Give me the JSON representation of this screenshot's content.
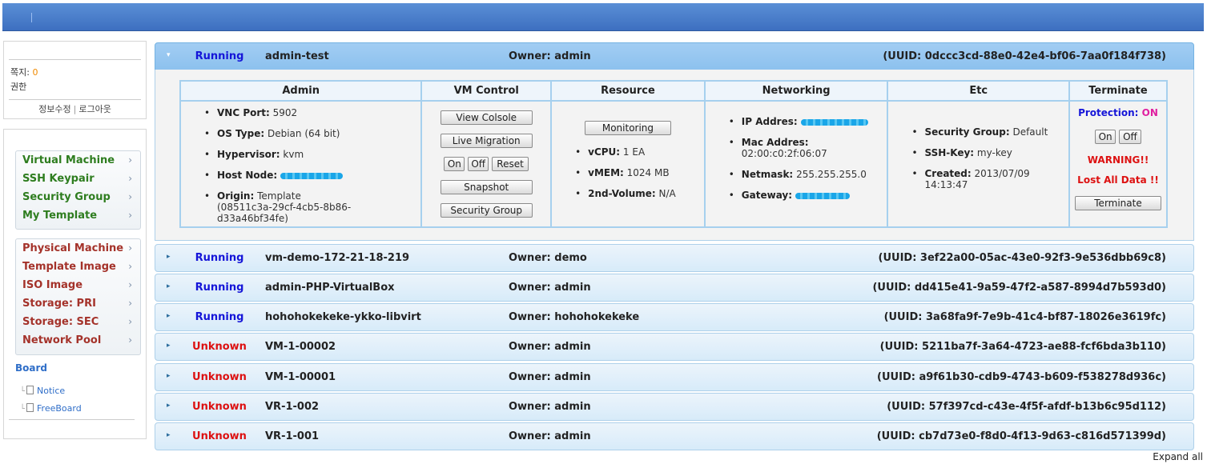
{
  "topbar": {
    "tick": "|"
  },
  "userbox": {
    "messages_label": "쪽지:",
    "messages_count": "0",
    "permission_label": "권한",
    "edit_info": "정보수정",
    "separator": "|",
    "logout": "로그아웃"
  },
  "menu": {
    "group1": [
      {
        "label": "Virtual Machine"
      },
      {
        "label": "SSH Keypair"
      },
      {
        "label": "Security Group"
      },
      {
        "label": "My Template"
      }
    ],
    "group2": [
      {
        "label": "Physical Machine"
      },
      {
        "label": "Template Image"
      },
      {
        "label": "ISO Image"
      },
      {
        "label": "Storage: PRI"
      },
      {
        "label": "Storage: SEC"
      },
      {
        "label": "Network Pool"
      }
    ],
    "chevron": "›",
    "board_title": "Board",
    "board_items": [
      {
        "label": "Notice"
      },
      {
        "label": "FreeBoard"
      }
    ],
    "tree_glyph": "└"
  },
  "vms": [
    {
      "status": "Running",
      "name": "admin-test",
      "owner": "Owner: admin",
      "uuid": "(UUID: 0dccc3cd-88e0-42e4-bf06-7aa0f184f738)"
    },
    {
      "status": "Running",
      "name": "vm-demo-172-21-18-219",
      "owner": "Owner: demo",
      "uuid": "(UUID: 3ef22a00-05ac-43e0-92f3-9e536dbb69c8)"
    },
    {
      "status": "Running",
      "name": "admin-PHP-VirtualBox",
      "owner": "Owner: admin",
      "uuid": "(UUID: dd415e41-9a59-47f2-a587-8994d7b593d0)"
    },
    {
      "status": "Running",
      "name": "hohohokekeke-ykko-libvirt",
      "owner": "Owner: hohohokekeke",
      "uuid": "(UUID: 3a68fa9f-7e9b-41c4-bf87-18026e3619fc)"
    },
    {
      "status": "Unknown",
      "name": "VM-1-00002",
      "owner": "Owner: admin",
      "uuid": "(UUID: 5211ba7f-3a64-4723-ae88-fcf6bda3b110)"
    },
    {
      "status": "Unknown",
      "name": "VM-1-00001",
      "owner": "Owner: admin",
      "uuid": "(UUID: a9f61b30-cdb9-4743-b609-f538278d936c)"
    },
    {
      "status": "Unknown",
      "name": "VR-1-002",
      "owner": "Owner: admin",
      "uuid": "(UUID: 57f397cd-c43e-4f5f-afdf-b13b6c95d112)"
    },
    {
      "status": "Unknown",
      "name": "VR-1-001",
      "owner": "Owner: admin",
      "uuid": "(UUID: cb7d73e0-f8d0-4f13-9d63-c816d571399d)"
    }
  ],
  "arrows": {
    "open": "▾",
    "closed": "▸"
  },
  "detail": {
    "headers": {
      "admin": "Admin",
      "vm_control": "VM Control",
      "resource": "Resource",
      "networking": "Networking",
      "etc": "Etc",
      "terminate": "Terminate"
    },
    "admin": {
      "vnc_label": "VNC Port:",
      "vnc_value": "5902",
      "os_label": "OS Type:",
      "os_value": "Debian (64 bit)",
      "hyp_label": "Hypervisor:",
      "hyp_value": "kvm",
      "node_label": "Host Node:",
      "origin_label": "Origin:",
      "origin_value": "Template",
      "origin_id": "(08511c3a-29cf-4cb5-8b86-d33a46bf34fe)"
    },
    "vm_control": {
      "view_console": "View Colsole",
      "live_migration": "Live Migration",
      "on": "On",
      "off": "Off",
      "reset": "Reset",
      "snapshot": "Snapshot",
      "security_group": "Security Group"
    },
    "resource": {
      "monitoring": "Monitoring",
      "vcpu_label": "vCPU:",
      "vcpu_value": "1 EA",
      "vmem_label": "vMEM:",
      "vmem_value": "1024 MB",
      "vol_label": "2nd-Volume:",
      "vol_value": "N/A"
    },
    "networking": {
      "ip_label": "IP Addres:",
      "mac_label": "Mac Addres:",
      "mac_value": "02:00:c0:2f:06:07",
      "mask_label": "Netmask:",
      "mask_value": "255.255.255.0",
      "gw_label": "Gateway:"
    },
    "etc": {
      "sg_label": "Security Group:",
      "sg_value": "Default",
      "ssh_label": "SSH-Key:",
      "ssh_value": "my-key",
      "created_label": "Created:",
      "created_date": "2013/07/09",
      "created_time": "14:13:47"
    },
    "terminate": {
      "protection_label": "Protection:",
      "protection_value": "ON",
      "on": "On",
      "off": "Off",
      "warning": "WARNING!!",
      "lost": "Lost All Data !!",
      "button": "Terminate"
    }
  },
  "expand_all": "Expand all",
  "colors": {
    "running": "#1515d8",
    "unknown": "#dd1111",
    "menu_green": "#2e7d1f",
    "menu_red": "#a4322a",
    "link_blue": "#2f6ec8",
    "topbar": "#3d6fc0",
    "protection_on": "#e020a0"
  }
}
